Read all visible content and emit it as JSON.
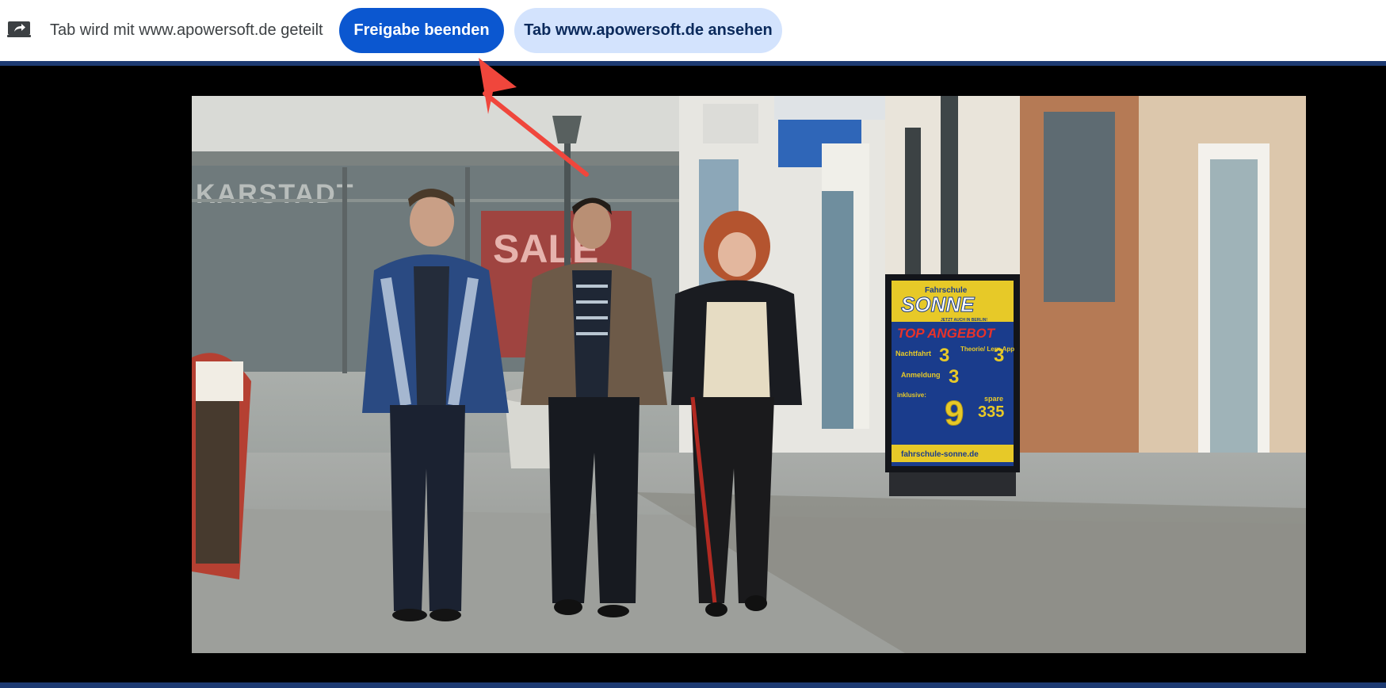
{
  "share_bar": {
    "status_text": "Tab wird mit www.apowersoft.de geteilt",
    "stop_button": "Freigabe beenden",
    "view_button": "Tab www.apowersoft.de ansehen"
  },
  "video_scene": {
    "store_sign": "KARSTADT",
    "sale_sign": "SALE",
    "poster": {
      "header_small": "Fahrschule",
      "brand": "SONNE",
      "tagline": "JETZT AUCH IN BERLIN!",
      "offer": "TOP ANGEBOT",
      "item1_label": "Nachtfahrt",
      "item1_price": "3",
      "item2_label": "Theorie/ Lern App",
      "item2_price": "3",
      "item3_label": "Anmeldung",
      "item3_price": "3",
      "inclusive_label": "inklusive:",
      "big_price": "9",
      "save_label": "spare",
      "save_amount": "335",
      "url": "fahrschule-sonne.de"
    }
  },
  "colors": {
    "accent_primary": "#0b57d0",
    "accent_secondary": "#d3e3fd",
    "divider": "#1d3a72",
    "arrow": "#f0463c"
  },
  "icons": {
    "share": "screen-share-icon"
  }
}
